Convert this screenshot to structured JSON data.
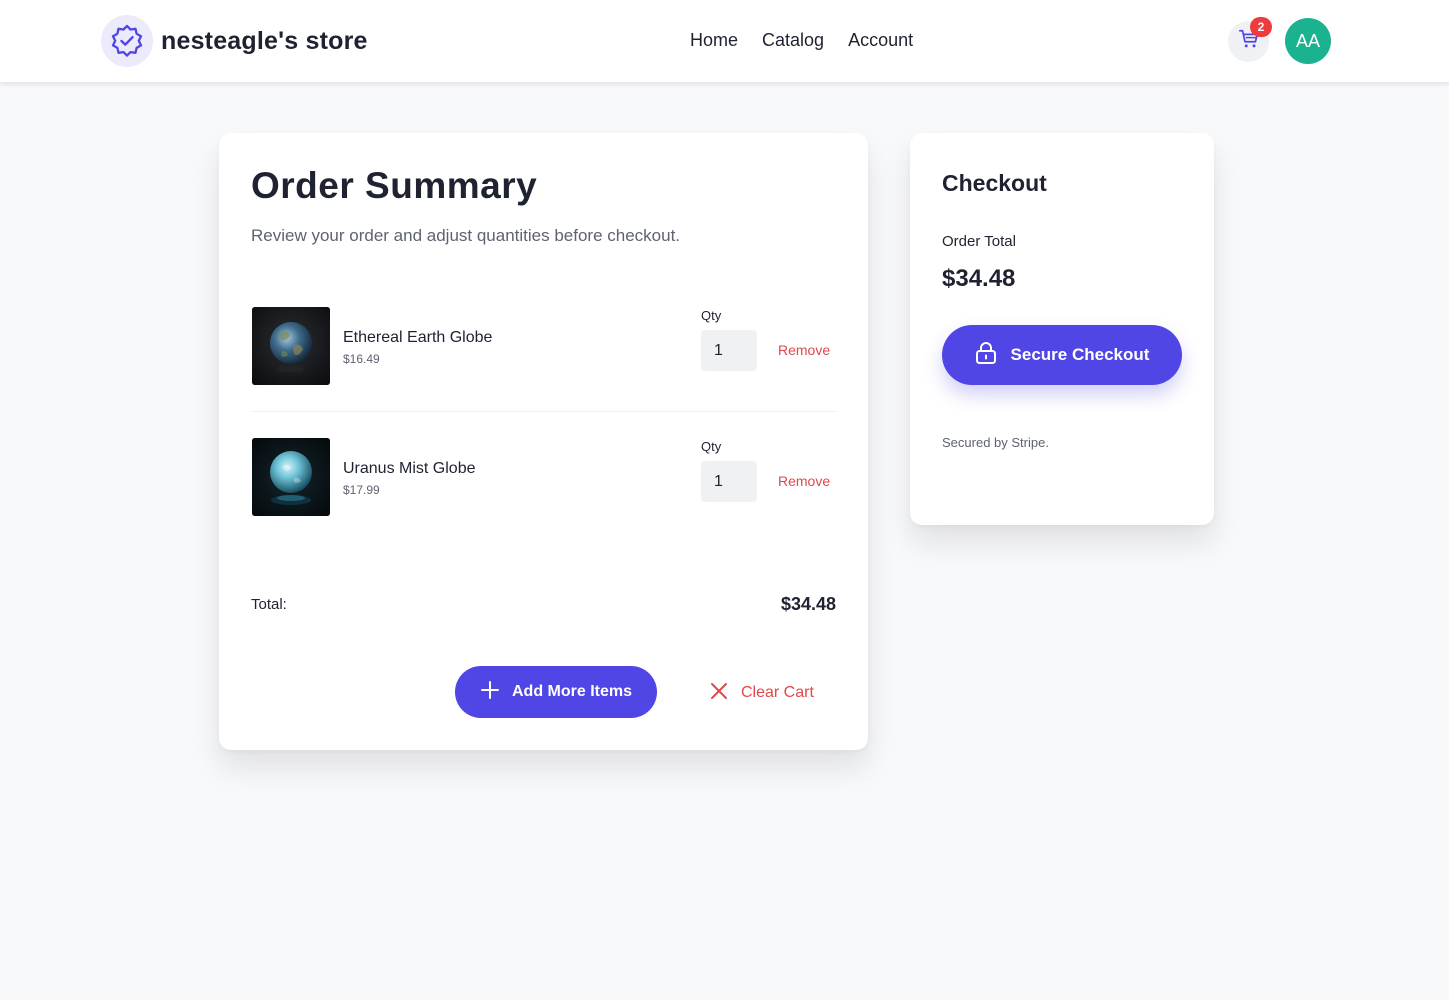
{
  "header": {
    "brand_name": "nesteagle's store",
    "nav": [
      "Home",
      "Catalog",
      "Account"
    ],
    "cart_count": "2",
    "avatar_initials": "AA"
  },
  "order": {
    "title": "Order Summary",
    "subtitle": "Review your order and adjust quantities before checkout.",
    "items": [
      {
        "name": "Ethereal Earth Globe",
        "price": "$16.49",
        "qty_label": "Qty",
        "qty": "1",
        "remove_label": "Remove"
      },
      {
        "name": "Uranus Mist Globe",
        "price": "$17.99",
        "qty_label": "Qty",
        "qty": "1",
        "remove_label": "Remove"
      }
    ],
    "total_label": "Total:",
    "total_value": "$34.48",
    "add_more_label": "Add More Items",
    "clear_cart_label": "Clear Cart"
  },
  "checkout": {
    "title": "Checkout",
    "order_total_label": "Order Total",
    "order_total_value": "$34.48",
    "secure_checkout_label": "Secure Checkout",
    "note": "Secured by Stripe."
  },
  "colors": {
    "accent": "#4f46e5",
    "danger": "#e14848",
    "avatar": "#1bb28f",
    "badge": "#ef3b3b"
  },
  "icons": [
    "verified-badge-icon",
    "cart-icon",
    "plus-icon",
    "close-icon",
    "lock-icon"
  ]
}
